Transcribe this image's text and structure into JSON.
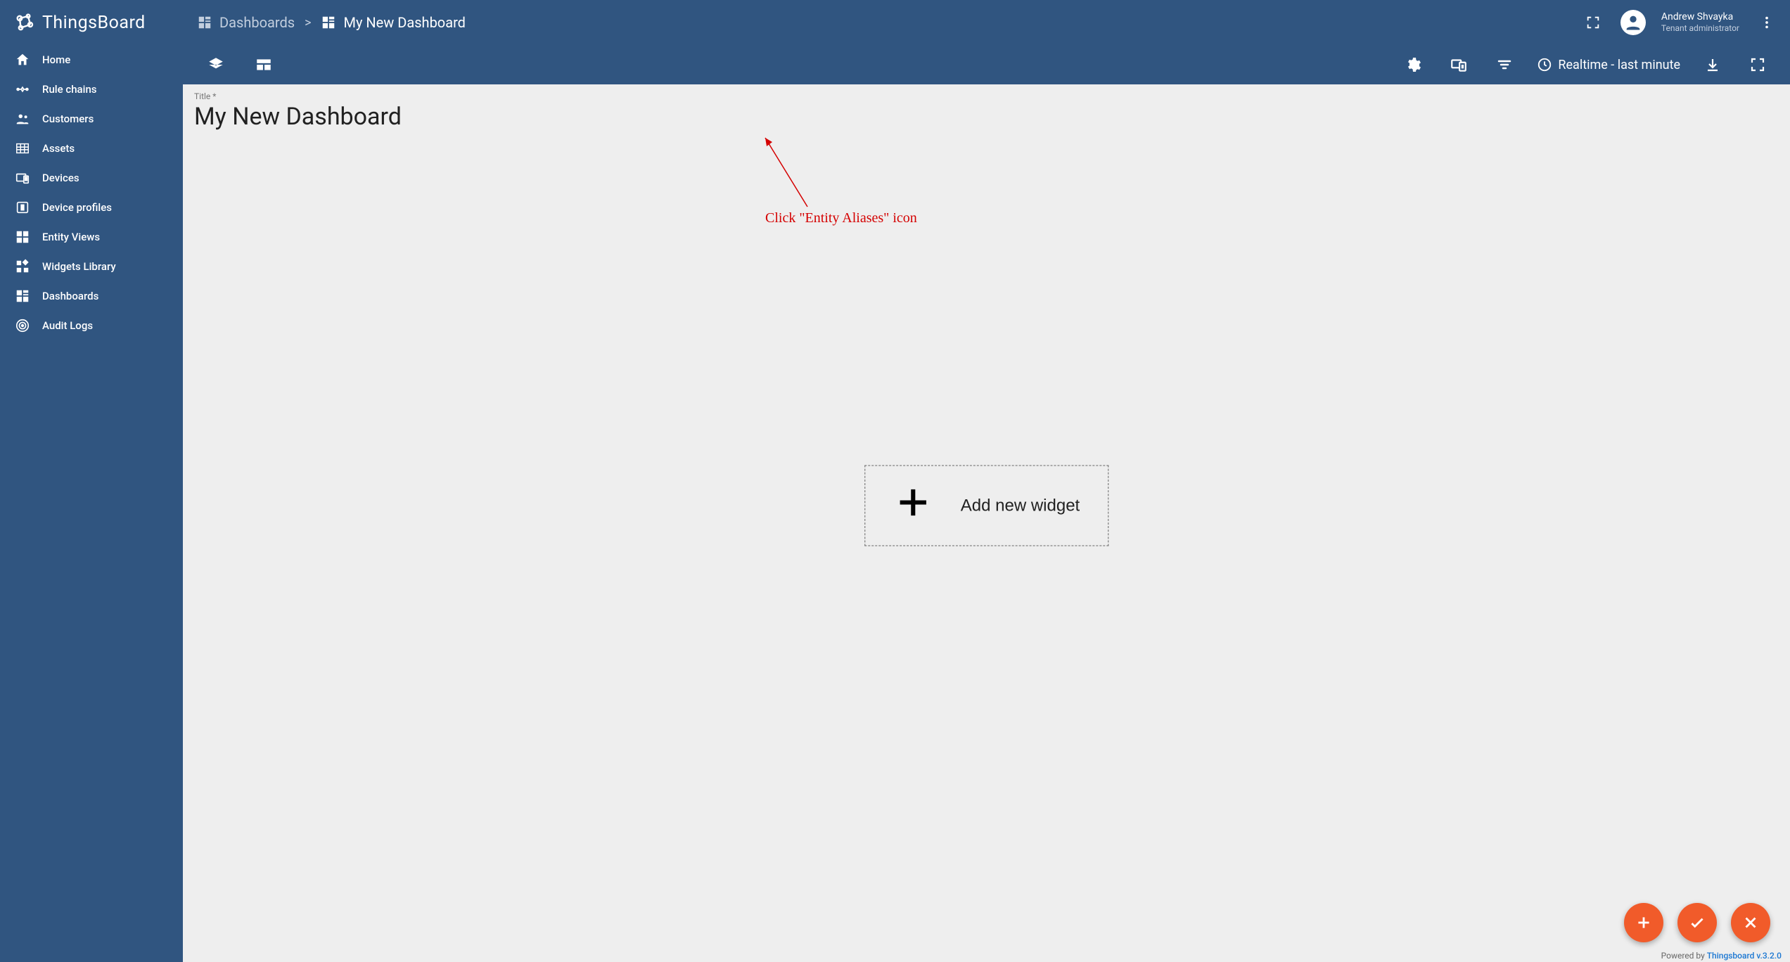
{
  "app": {
    "name": "ThingsBoard"
  },
  "breadcrumb": {
    "root": "Dashboards",
    "current": "My New Dashboard"
  },
  "user": {
    "name": "Andrew Shvayka",
    "role": "Tenant administrator"
  },
  "sidebar": {
    "items": [
      {
        "label": "Home",
        "icon": "home-icon"
      },
      {
        "label": "Rule chains",
        "icon": "rule-chains-icon"
      },
      {
        "label": "Customers",
        "icon": "customers-icon"
      },
      {
        "label": "Assets",
        "icon": "assets-icon"
      },
      {
        "label": "Devices",
        "icon": "devices-icon"
      },
      {
        "label": "Device profiles",
        "icon": "device-profiles-icon"
      },
      {
        "label": "Entity Views",
        "icon": "entity-views-icon"
      },
      {
        "label": "Widgets Library",
        "icon": "widgets-library-icon"
      },
      {
        "label": "Dashboards",
        "icon": "dashboards-icon"
      },
      {
        "label": "Audit Logs",
        "icon": "audit-logs-icon"
      }
    ]
  },
  "toolbar": {
    "timewindow_label": "Realtime - last minute"
  },
  "dashboard": {
    "title_label": "Title *",
    "title": "My New Dashboard",
    "add_widget_label": "Add new widget"
  },
  "footer": {
    "powered_by": "Powered by ",
    "link_text": "Thingsboard v.3.2.0"
  },
  "annotation": {
    "text": "Click \"Entity Aliases\" icon"
  }
}
